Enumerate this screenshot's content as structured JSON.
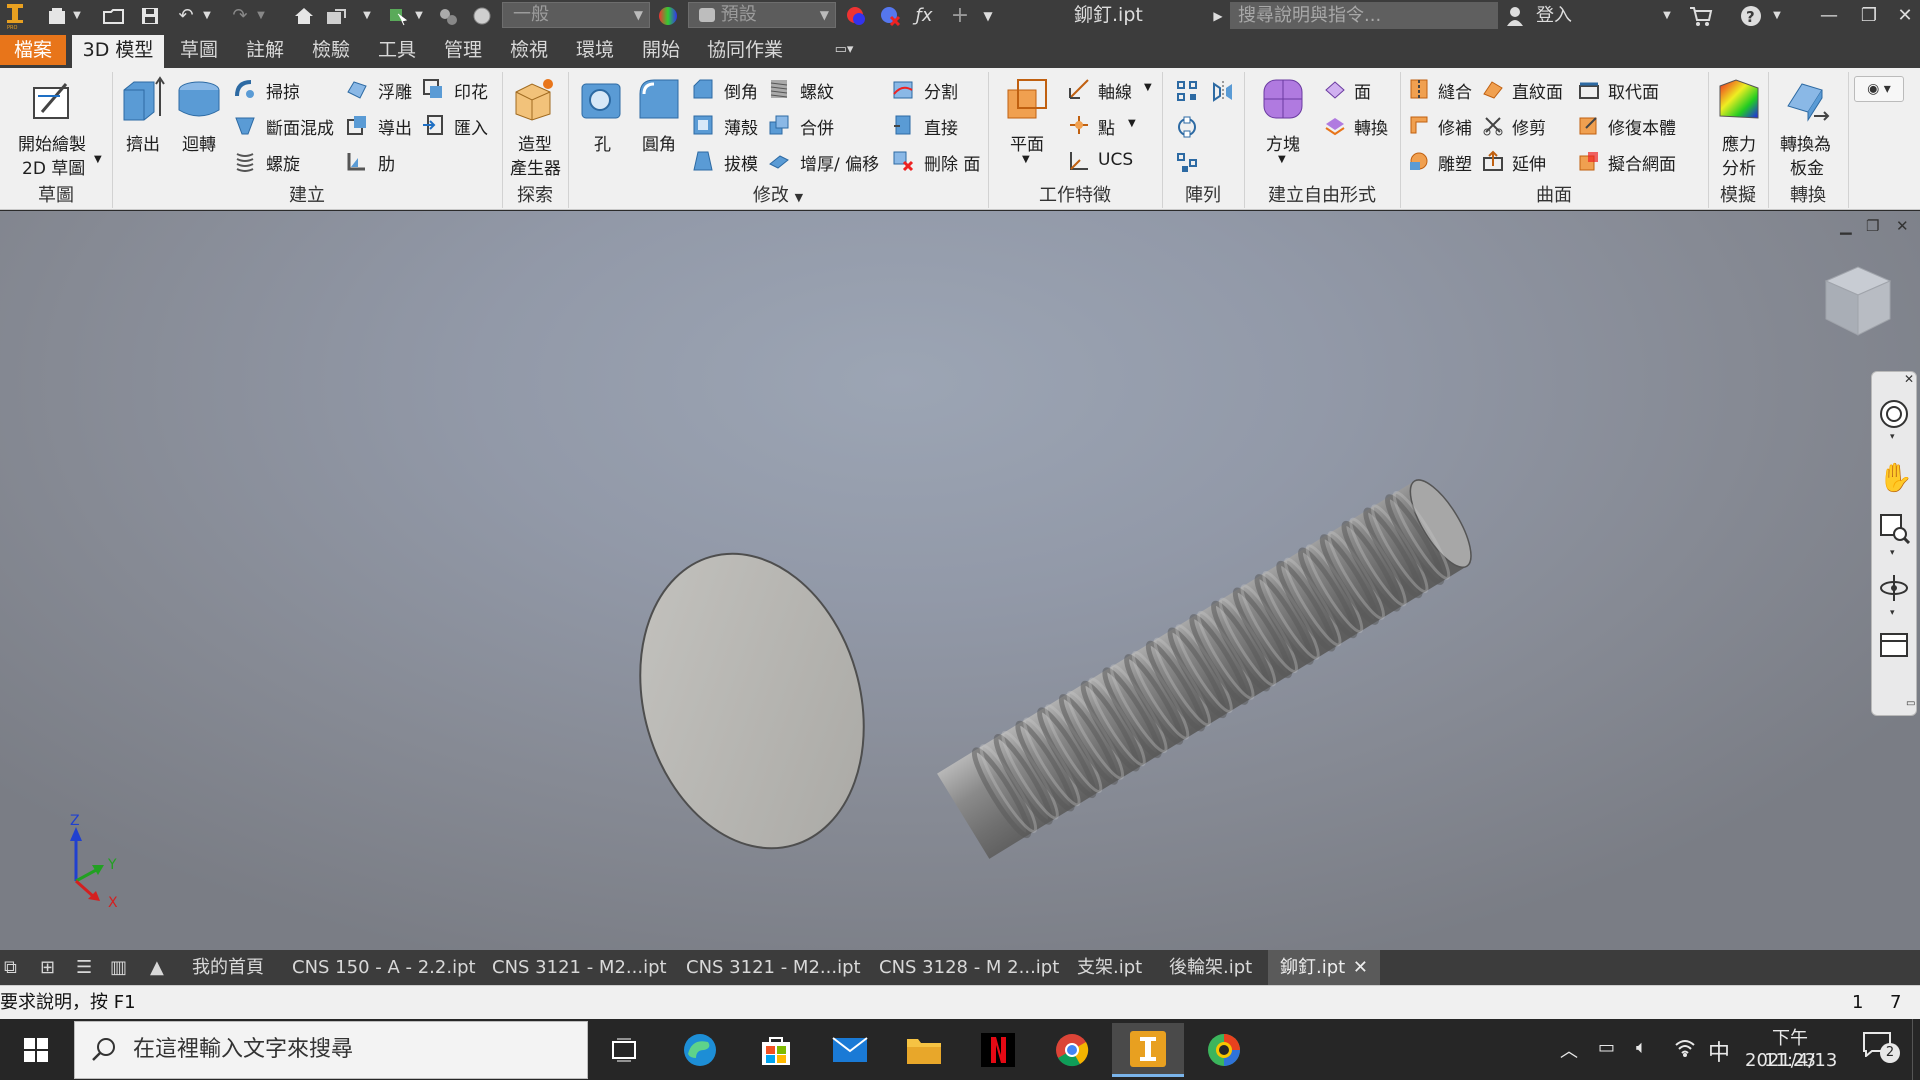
{
  "titlebar": {
    "style_combo": "一般",
    "appearance_combo": "預設",
    "doc_title": "鉚釘.ipt",
    "search_placeholder": "搜尋說明與指令...",
    "signin": "登入"
  },
  "tabs": [
    {
      "label": "檔案"
    },
    {
      "label": "3D 模型"
    },
    {
      "label": "草圖"
    },
    {
      "label": "註解"
    },
    {
      "label": "檢驗"
    },
    {
      "label": "工具"
    },
    {
      "label": "管理"
    },
    {
      "label": "檢視"
    },
    {
      "label": "環境"
    },
    {
      "label": "開始"
    },
    {
      "label": "協同作業"
    }
  ],
  "ribbon": {
    "sketch": {
      "start_line1": "開始繪製",
      "start_line2": "2D 草圖",
      "group": "草圖"
    },
    "create": {
      "extrude": "擠出",
      "revolve": "迴轉",
      "sweep": "掃掠",
      "loft": "斷面混成",
      "coil": "螺旋",
      "emboss": "浮雕",
      "derive": "導出",
      "rib": "肋",
      "decal": "印花",
      "import": "匯入",
      "group": "建立"
    },
    "explore": {
      "line1": "造型",
      "line2": "產生器",
      "group": "探索"
    },
    "modify": {
      "hole": "孔",
      "fillet": "圓角",
      "chamfer": "倒角",
      "shell": "薄殼",
      "draft": "拔模",
      "thread": "螺紋",
      "combine": "合併",
      "thicken": "增厚/ 偏移",
      "split": "分割",
      "direct": "直接",
      "delete_face": "刪除 面",
      "group": "修改"
    },
    "work": {
      "plane": "平面",
      "axis": "軸線",
      "point": "點",
      "ucs": "UCS",
      "group": "工作特徵"
    },
    "pattern": {
      "group": "陣列"
    },
    "freeform": {
      "box": "方塊",
      "face": "面",
      "convert": "轉換",
      "group": "建立自由形式"
    },
    "surface": {
      "stitch": "縫合",
      "patch": "修補",
      "sculpt": "雕塑",
      "ruled": "直紋面",
      "trim": "修剪",
      "extend": "延伸",
      "replace": "取代面",
      "repair": "修復本體",
      "fit_mesh": "擬合網面",
      "group": "曲面"
    },
    "simulation": {
      "line1": "應力",
      "line2": "分析",
      "group": "模擬"
    },
    "convert": {
      "line1": "轉換為",
      "line2": "板金",
      "group": "轉換"
    }
  },
  "doc_tabs": [
    {
      "label": "我的首頁"
    },
    {
      "label": "CNS 150 - A - 2.2.ipt"
    },
    {
      "label": "CNS 3121 - M2...ipt"
    },
    {
      "label": "CNS 3121 - M2...ipt"
    },
    {
      "label": "CNS 3128 - M 2...ipt"
    },
    {
      "label": "支架.ipt"
    },
    {
      "label": "後輪架.ipt"
    },
    {
      "label": "鉚釘.ipt"
    }
  ],
  "status": {
    "help": "要求說明，按 F1",
    "count1": "1",
    "count2": "7"
  },
  "axes": {
    "x": "X",
    "y": "Y",
    "z": "Z"
  },
  "taskbar": {
    "search_placeholder": "在這裡輸入文字來搜尋",
    "time": "下午 11:23",
    "date": "2021/4/13",
    "ime": "中",
    "notifications": "2"
  },
  "colors": {
    "file_tab": "#e8751a",
    "viewport_top": "#9ca5b4",
    "viewport_bottom": "#7a7d85",
    "axis_x": "#d42020",
    "axis_y": "#22a022",
    "axis_z": "#2040d0"
  }
}
